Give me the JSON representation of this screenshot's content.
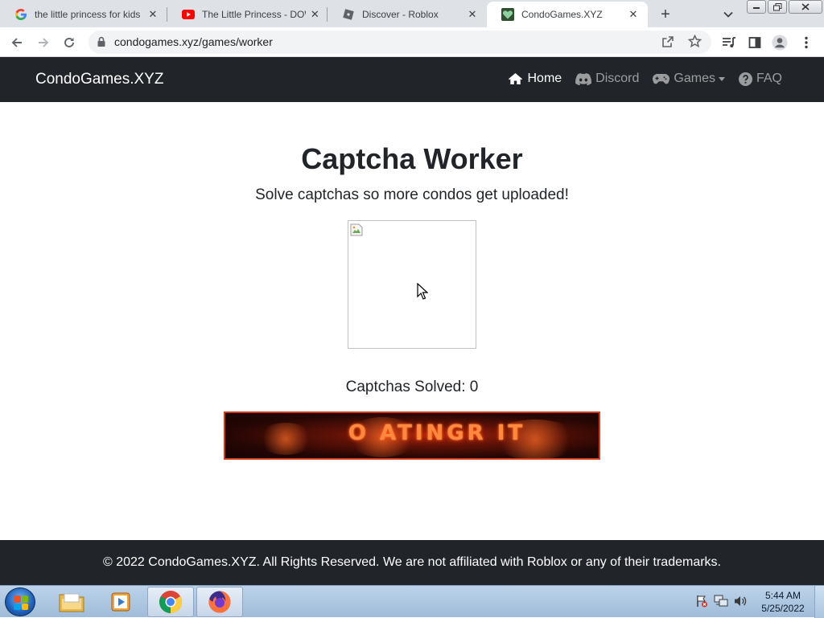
{
  "browser": {
    "tabs": [
      {
        "title": "the little princess for kids",
        "favicon": "google-icon",
        "active": false
      },
      {
        "title": "The Little Princess - DOWNLOAD",
        "favicon": "youtube-icon",
        "active": false
      },
      {
        "title": "Discover - Roblox",
        "favicon": "roblox-icon",
        "active": false
      },
      {
        "title": "CondoGames.XYZ",
        "favicon": "condogames-icon",
        "active": true
      }
    ],
    "url": "condogames.xyz/games/worker"
  },
  "site": {
    "brand": "CondoGames.XYZ",
    "nav": [
      {
        "label": "Home",
        "icon": "home-icon",
        "active": true
      },
      {
        "label": "Discord",
        "icon": "discord-icon",
        "active": false
      },
      {
        "label": "Games",
        "icon": "gamepad-icon",
        "active": false,
        "dropdown": true
      },
      {
        "label": "FAQ",
        "icon": "question-circle-icon",
        "active": false
      }
    ]
  },
  "main": {
    "title": "Captcha Worker",
    "subtitle": "Solve captchas so more condos get uploaded!",
    "solved_label": "Captchas Solved: 0",
    "banner_text": "O ATINGR IT"
  },
  "footer": {
    "text": "© 2022 CondoGames.XYZ. All Rights Reserved. We are not affiliated with Roblox or any of their trademarks."
  },
  "taskbar": {
    "time": "5:44 AM",
    "date": "5/25/2022"
  },
  "colors": {
    "navbar_bg": "#212529",
    "banner_border": "#d13a1a",
    "accent_orange": "#ff8a3d"
  }
}
